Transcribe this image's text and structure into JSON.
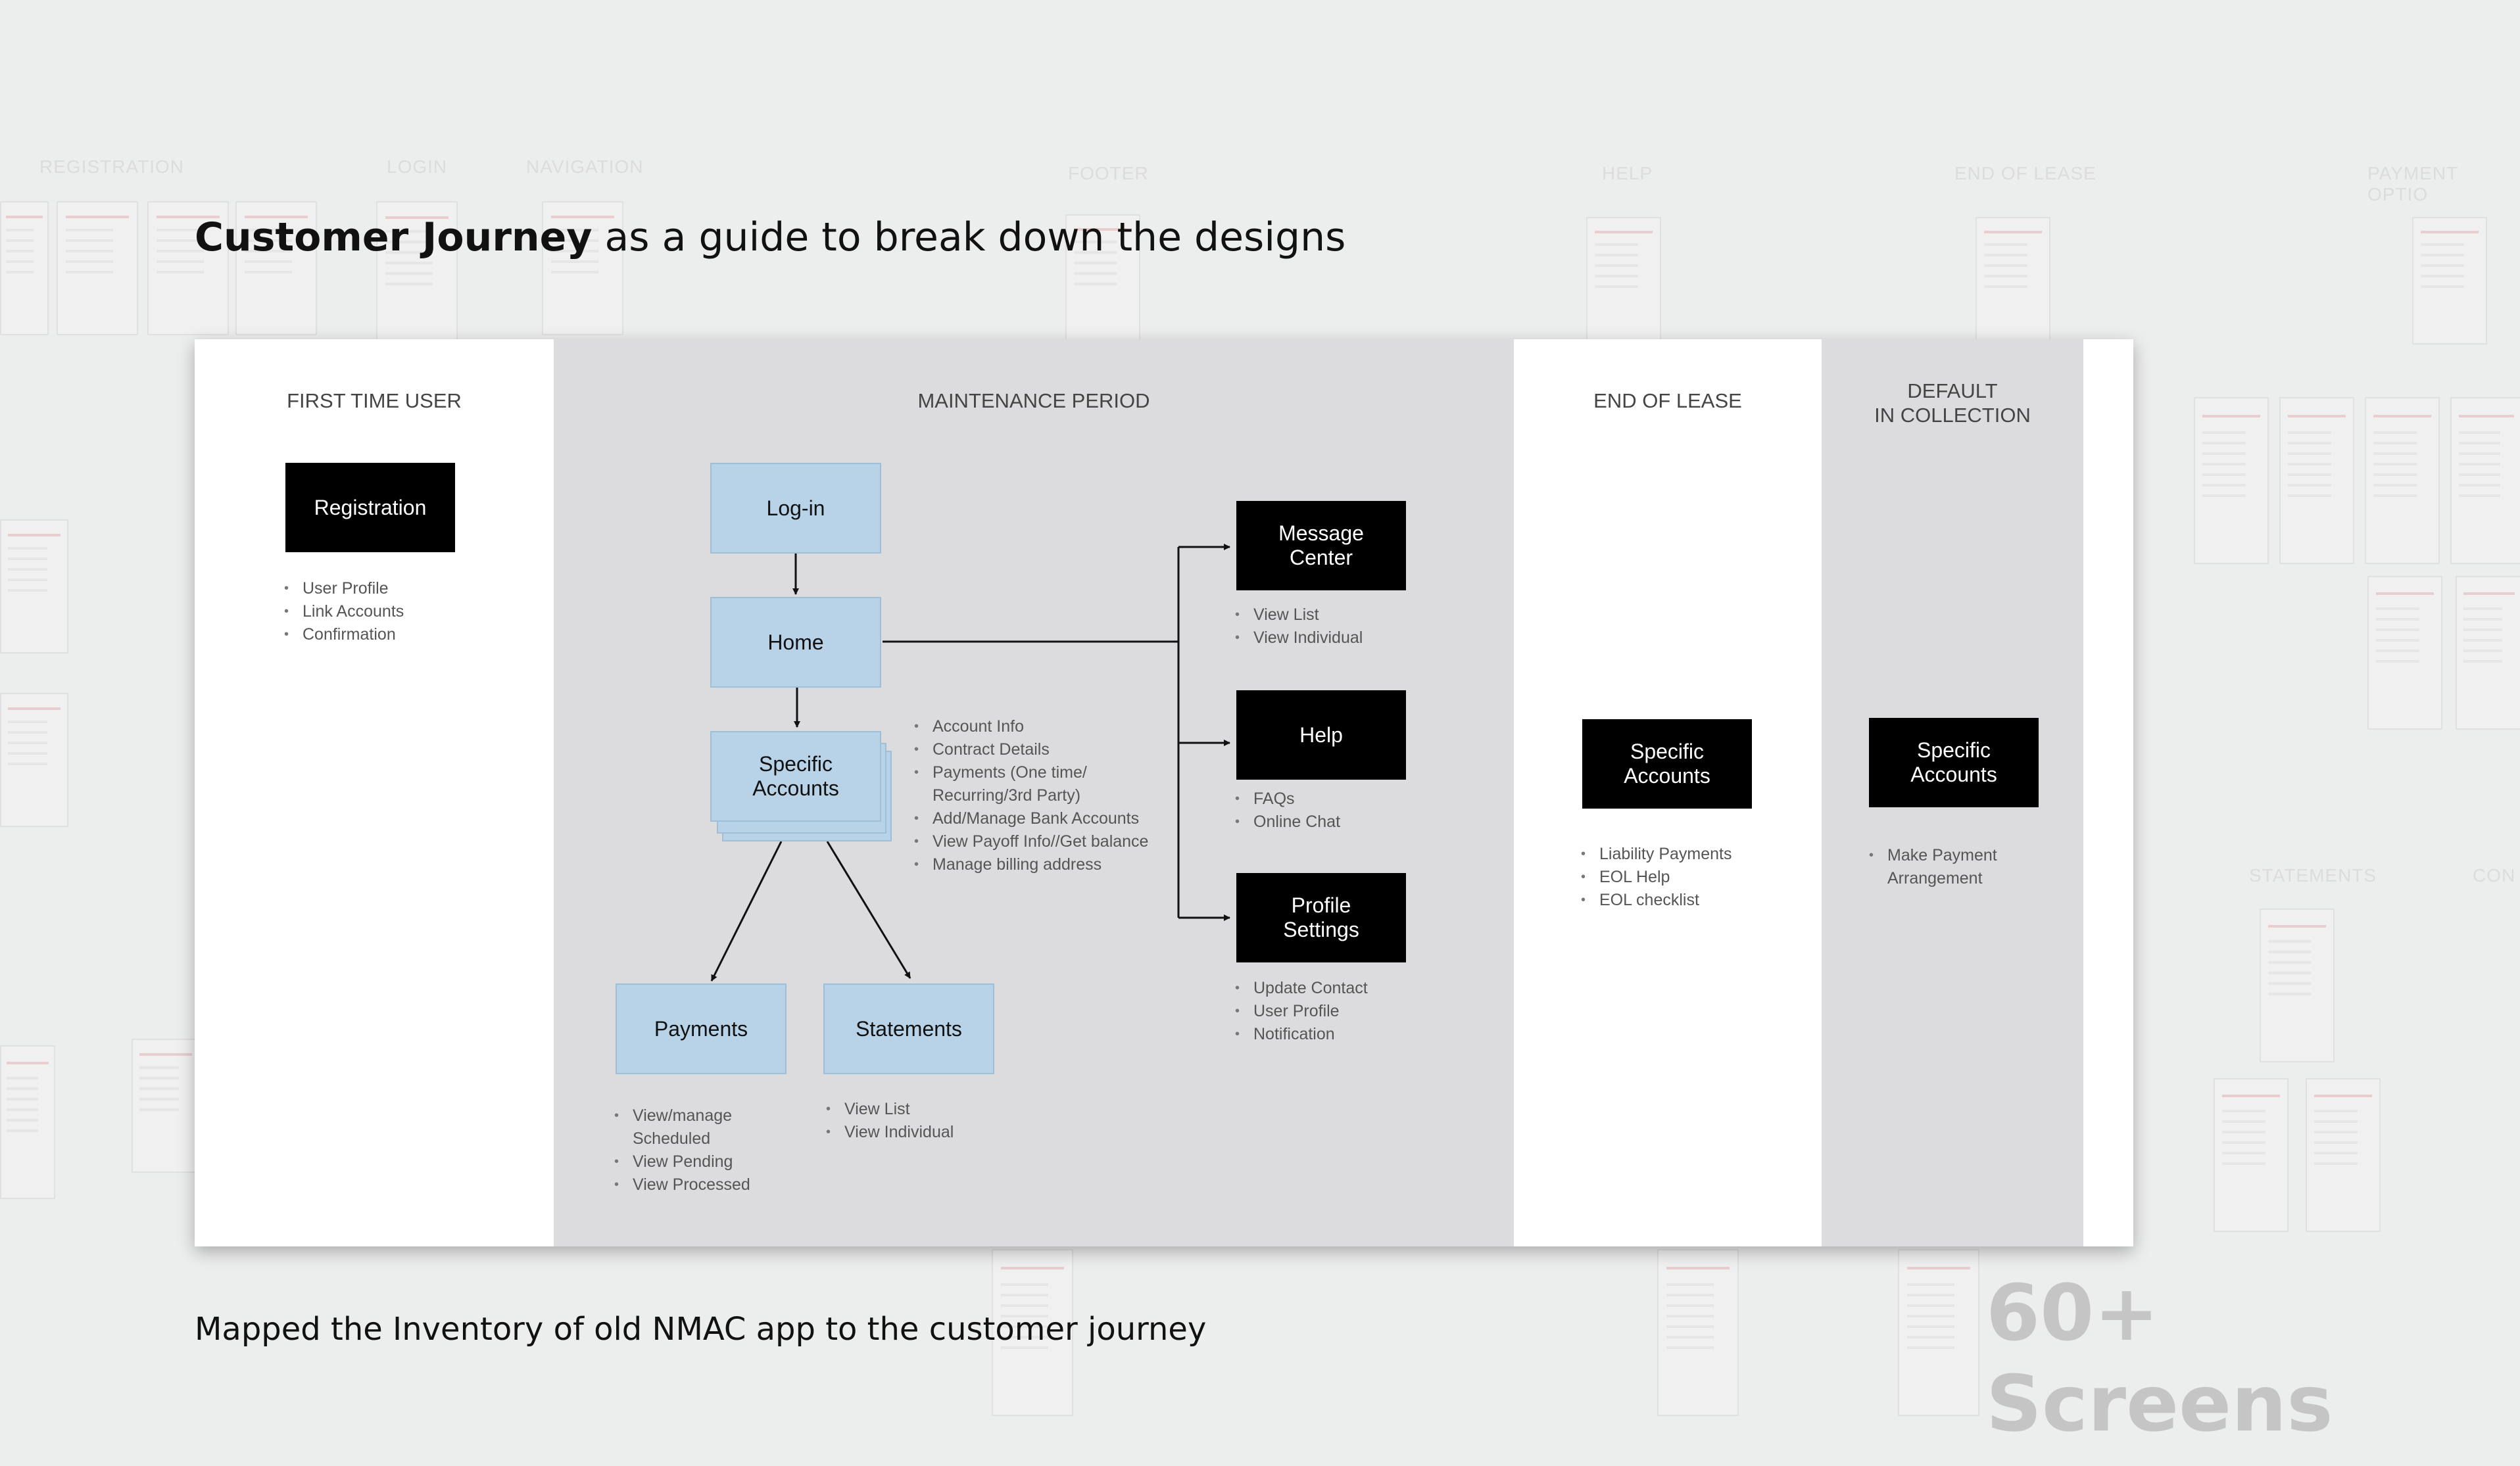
{
  "headline": {
    "bold": "Customer Journey",
    "rest": " as a guide to break down the designs"
  },
  "caption": "Mapped the Inventory of old NMAC app to the customer journey",
  "screens_label": "60+ Screens",
  "background_labels": [
    "REGISTRATION",
    "LOGIN",
    "NAVIGATION",
    "FOOTER",
    "HELP",
    "END OF LEASE",
    "PAYMENT OPTIO",
    "STATEMENTS",
    "CON"
  ],
  "lanes": {
    "first_time_user": {
      "title": "FIRST TIME USER",
      "registration": "Registration",
      "registration_items": [
        "User Profile",
        "Link Accounts",
        "Confirmation"
      ]
    },
    "maintenance": {
      "title": "MAINTENANCE PERIOD",
      "login": "Log-in",
      "home": "Home",
      "specific_accounts": "Specific\nAccounts",
      "specific_accounts_items": [
        "Account Info",
        "Contract Details",
        "Payments (One time/\nRecurring/3rd Party)",
        "Add/Manage Bank Accounts",
        "View Payoff Info//Get balance",
        "Manage billing address"
      ],
      "payments": "Payments",
      "payments_items": [
        "View/manage\nScheduled",
        "View Pending",
        "View Processed"
      ],
      "statements": "Statements",
      "statements_items": [
        "View List",
        "View Individual"
      ],
      "message_center": "Message\nCenter",
      "message_center_items": [
        "View List",
        "View Individual"
      ],
      "help": "Help",
      "help_items": [
        "FAQs",
        "Online Chat"
      ],
      "profile_settings": "Profile\nSettings",
      "profile_settings_items": [
        "Update Contact",
        "User Profile",
        "Notification"
      ]
    },
    "end_of_lease": {
      "title": "END OF LEASE",
      "specific_accounts": "Specific\nAccounts",
      "items": [
        "Liability Payments",
        "EOL Help",
        "EOL checklist"
      ]
    },
    "default": {
      "title": "DEFAULT\nIN COLLECTION",
      "specific_accounts": "Specific\nAccounts",
      "items": [
        "Make Payment\nArrangement"
      ]
    }
  },
  "colors": {
    "lane_gray": "#dcdcde",
    "node_blue": "#b8d3e8",
    "node_black": "#000000",
    "page_bg": "#eceded"
  }
}
